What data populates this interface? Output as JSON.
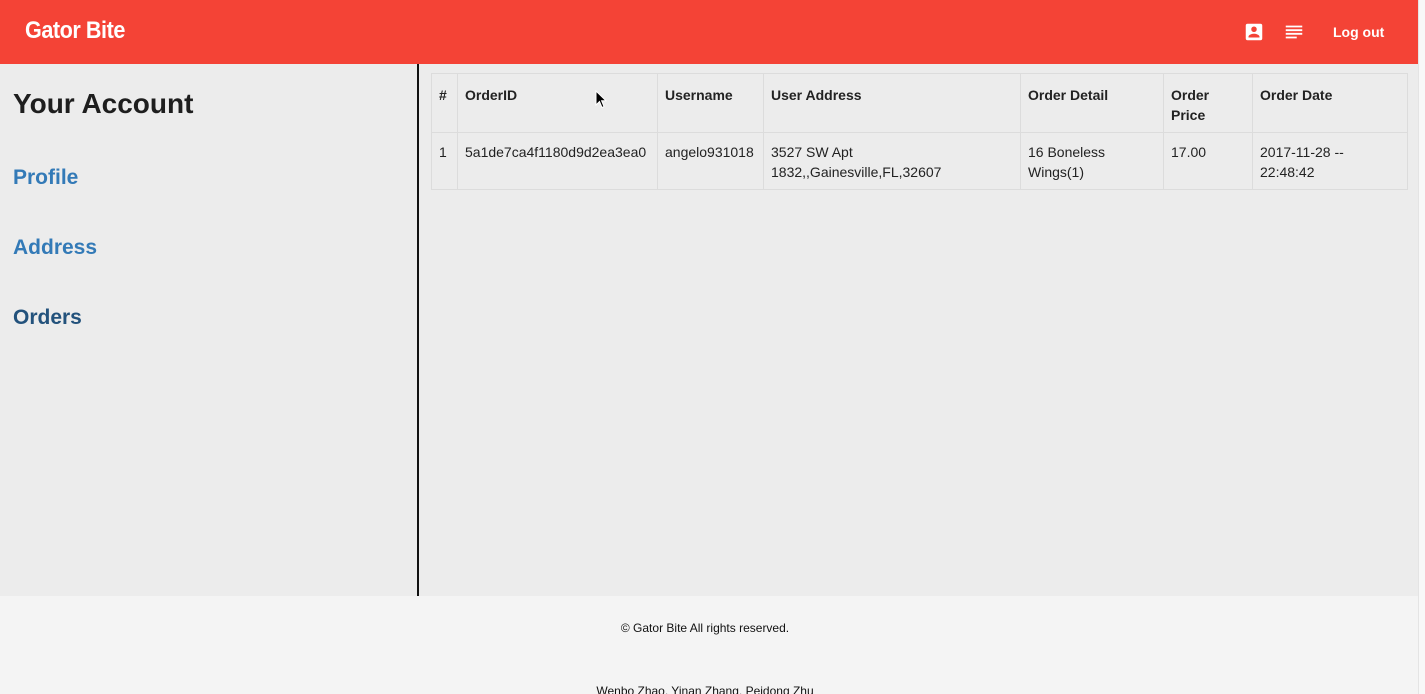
{
  "navbar": {
    "brand": "Gator Bite",
    "logout_label": "Log out",
    "icons": [
      "account-box-icon",
      "list-icon"
    ],
    "accent_color": "#f44336"
  },
  "sidebar": {
    "title": "Your Account",
    "links": [
      {
        "label": "Profile"
      },
      {
        "label": "Address"
      },
      {
        "label": "Orders"
      }
    ]
  },
  "orders_table": {
    "headers": [
      "#",
      "OrderID",
      "Username",
      "User Address",
      "Order Detail",
      "Order Price",
      "Order Date"
    ],
    "rows": [
      [
        "1",
        "5a1de7ca4f1180d9d2ea3ea0",
        "angelo931018",
        "3527 SW Apt 1832,,Gainesville,FL,32607",
        "16 Boneless Wings(1)",
        "17.00",
        "2017-11-28 -- 22:48:42"
      ]
    ]
  },
  "footer": {
    "copyright": "© Gator Bite All rights reserved.",
    "credits": "Wenbo Zhao, Yinan Zhang, Peidong Zhu"
  }
}
